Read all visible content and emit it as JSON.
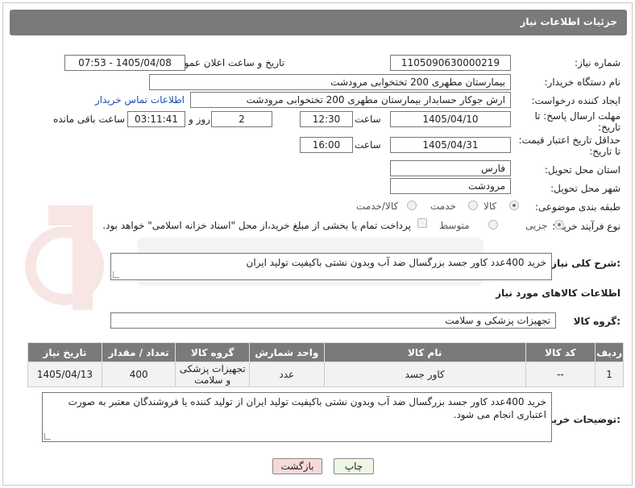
{
  "header": {
    "title": "جزئیات اطلاعات نیاز"
  },
  "fields": {
    "need_number_label": "شماره نیاز:",
    "need_number": "1105090630000219",
    "announce_label": "تاریخ و ساعت اعلان عمومی:",
    "announce_value": "1405/04/08 - 07:53",
    "buyer_org_label": "نام دستگاه خریدار:",
    "buyer_org": "بیمارستان مطهری  200 تختخوابی مرودشت",
    "creator_label": "ایجاد کننده درخواست:",
    "creator": "ارش  جوکار حسابدار بیمارستان مطهری  200 تختخوابی مرودشت",
    "contact_link": "اطلاعات تماس خریدار",
    "deadline_label_1": "مهلت ارسال پاسخ: تا",
    "deadline_label_2": "تاریخ:",
    "deadline_date": "1405/04/10",
    "time_label": "ساعت",
    "deadline_time": "12:30",
    "days": "2",
    "days_label": "روز و",
    "remaining": "03:11:41",
    "remaining_label": "ساعت باقی مانده",
    "price_label_1": "حداقل تاریخ اعتبار قیمت:",
    "price_label_2": "تا تاریخ:",
    "price_date": "1405/04/31",
    "price_time": "16:00",
    "province_label": "استان محل تحویل:",
    "province": "فارس",
    "city_label": "شهر محل تحویل:",
    "city": "مرودشت",
    "category_label": "طبقه بندی موضوعی:",
    "cat_goods": "کالا",
    "cat_service": "خدمت",
    "cat_both": "کالا/خدمت",
    "process_label": "نوع فرآیند خرید :",
    "proc_partial": "جزیی",
    "proc_medium": "متوسط",
    "payment_note": "پرداخت تمام یا بخشی از مبلغ خرید،از محل \"اسناد خزانه اسلامی\" خواهد بود."
  },
  "summary": {
    "label": "شرح کلی نیاز:",
    "text": "خرید 400عدد کاور جسد بزرگسال ضد آب وبدون نشتی باکیفیت تولید ایران"
  },
  "goods_info_title": "اطلاعات کالاهای مورد نیاز",
  "goods_group": {
    "label": "گروه کالا:",
    "value": "تجهیزات پزشکی و سلامت"
  },
  "table": {
    "headers": [
      "ردیف",
      "کد کالا",
      "نام کالا",
      "واحد شمارش",
      "گروه کالا",
      "تعداد / مقدار",
      "تاریخ نیاز"
    ],
    "rows": [
      [
        "1",
        "--",
        "کاور جسد",
        "عدد",
        "تجهیزات پزشکی و سلامت",
        "400",
        "1405/04/13"
      ]
    ]
  },
  "buyer_notes": {
    "label": "توضیحات خریدار:",
    "text": "خرید 400عدد کاور جسد بزرگسال ضد آب وبدون نشتی باکیفیت تولید ایران از تولید کننده یا فروشندگان معتبر به صورت اعتباری انجام می شود."
  },
  "buttons": {
    "print": "چاپ",
    "back": "بازگشت"
  },
  "colors": {
    "header": "#7a7a7a",
    "link": "#1a4fb3",
    "back_button": "#f7d9d9",
    "print_button": "#eef7e6"
  }
}
